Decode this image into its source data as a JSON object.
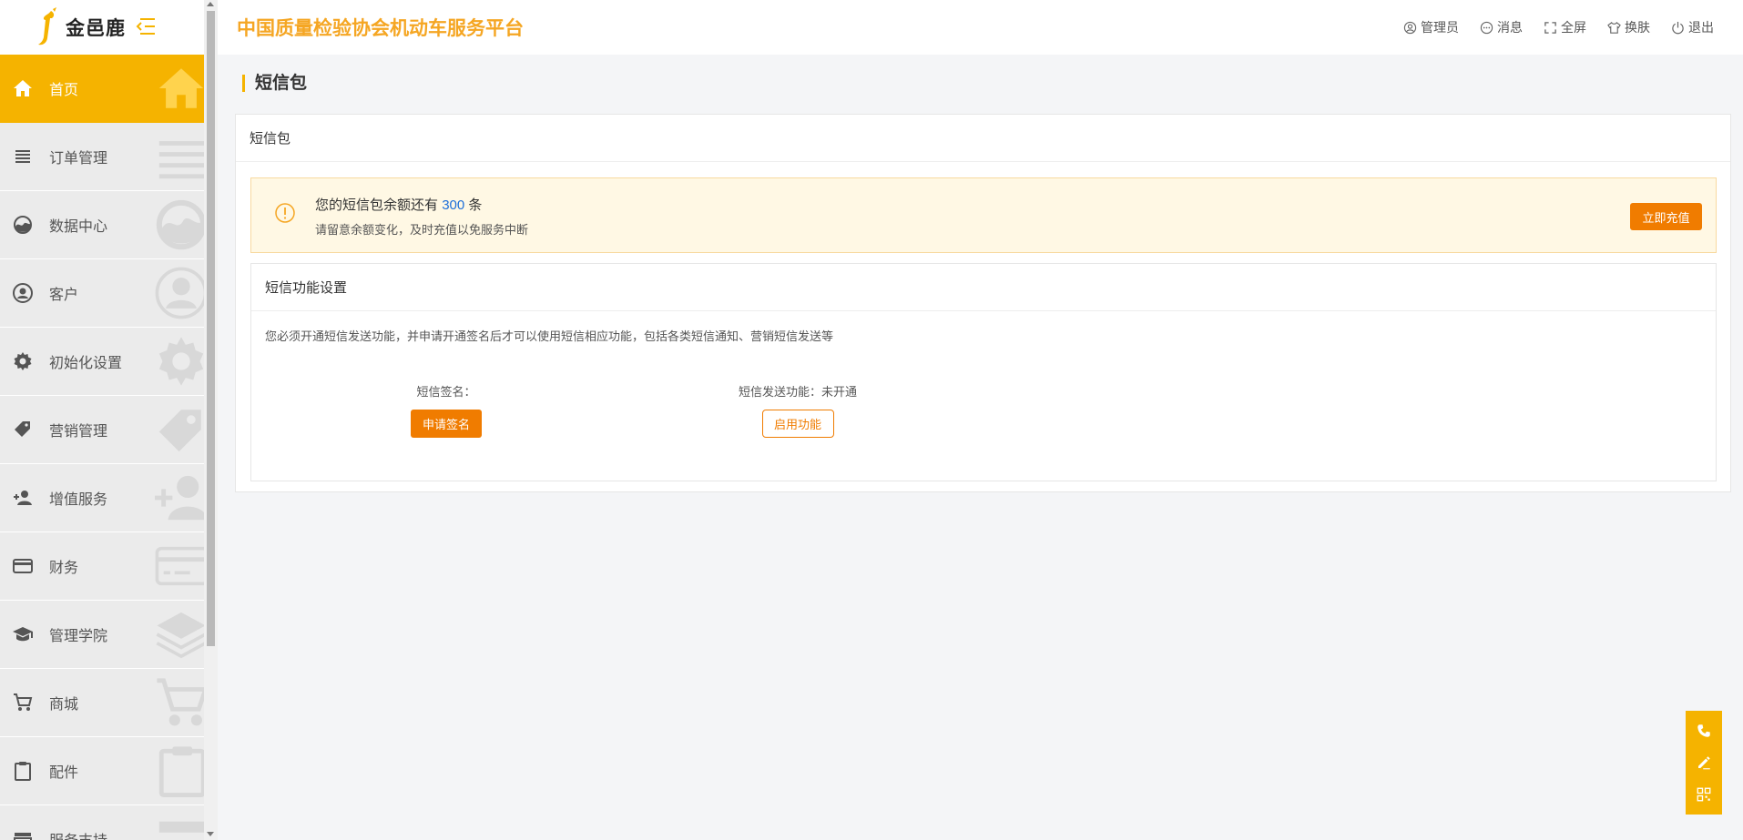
{
  "brand": {
    "name": "金邑鹿",
    "color": "#f5b300"
  },
  "header": {
    "title": "中国质量检验协会机动车服务平台",
    "tools": [
      {
        "icon": "user-circle-icon",
        "label": "管理员"
      },
      {
        "icon": "message-icon",
        "label": "消息"
      },
      {
        "icon": "fullscreen-icon",
        "label": "全屏"
      },
      {
        "icon": "shirt-icon",
        "label": "换肤"
      },
      {
        "icon": "power-icon",
        "label": "退出"
      }
    ]
  },
  "sidebar": {
    "items": [
      {
        "icon": "home-icon",
        "label": "首页",
        "active": true
      },
      {
        "icon": "list-icon",
        "label": "订单管理"
      },
      {
        "icon": "chart-icon",
        "label": "数据中心"
      },
      {
        "icon": "person-icon",
        "label": "客户"
      },
      {
        "icon": "gear-icon",
        "label": "初始化设置"
      },
      {
        "icon": "tag-icon",
        "label": "营销管理"
      },
      {
        "icon": "add-user-icon",
        "label": "增值服务"
      },
      {
        "icon": "card-icon",
        "label": "财务"
      },
      {
        "icon": "graduation-icon",
        "label": "管理学院"
      },
      {
        "icon": "cart-icon",
        "label": "商城"
      },
      {
        "icon": "clipboard-icon",
        "label": "配件"
      },
      {
        "icon": "support-icon",
        "label": "服务支持"
      }
    ]
  },
  "page": {
    "title": "短信包",
    "card_title": "短信包",
    "alert": {
      "prefix": "您的短信包余额还有",
      "count": "300",
      "suffix": "条",
      "note": "请留意余额变化，及时充值以免服务中断",
      "button": "立即充值"
    },
    "settings": {
      "title": "短信功能设置",
      "description": "您必须开通短信发送功能，并申请开通签名后才可以使用短信相应功能，包括各类短信通知、营销短信发送等",
      "signature_label": "短信签名：",
      "signature_button": "申请签名",
      "send_label": "短信发送功能：未开通",
      "send_button": "启用功能"
    }
  },
  "floatbar": {
    "icons": [
      "phone-icon",
      "edit-icon",
      "qrcode-icon"
    ]
  },
  "colors": {
    "accent": "#f5b300",
    "orange_button": "#f07c00",
    "alert_bg": "#fff8e4",
    "highlight_number": "#1e6fd9"
  }
}
